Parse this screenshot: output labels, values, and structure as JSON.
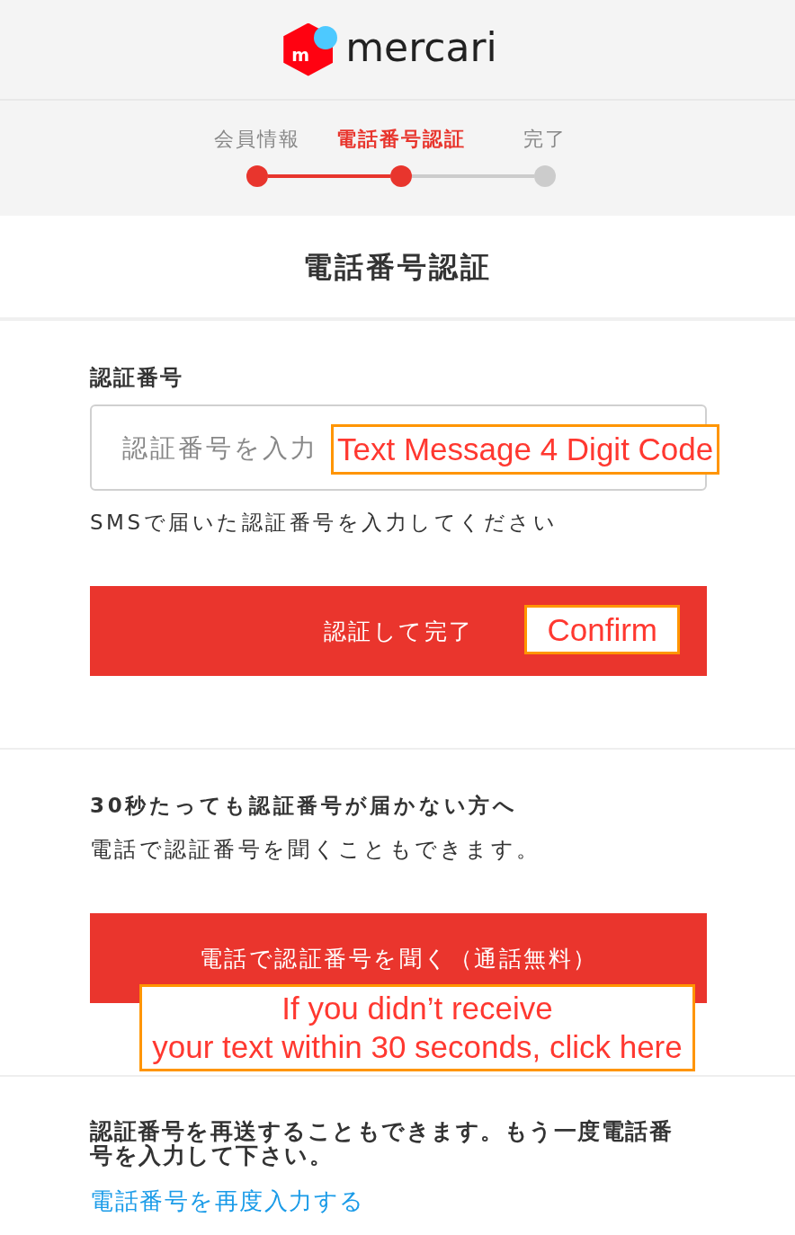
{
  "header": {
    "logo_mark": "m",
    "logo_text": "mercari"
  },
  "steps": [
    {
      "label": "会員情報",
      "selected": false,
      "reached": true
    },
    {
      "label": "電話番号認証",
      "selected": true,
      "reached": true
    },
    {
      "label": "完了",
      "selected": false,
      "reached": false
    }
  ],
  "page_title": "電話番号認証",
  "code_form": {
    "label": "認証番号",
    "input": {
      "placeholder": "認証番号を入力",
      "annotation": "Text Message 4 Digit Code"
    },
    "hint": "SMSで届いた認証番号を入力してください",
    "submit_button": {
      "label": "認証して完了",
      "annotation": "Confirm"
    }
  },
  "phone_call": {
    "heading": "30秒たっても認証番号が届かない方へ",
    "text": "電話で認証番号を聞くこともできます。",
    "button": {
      "label": "電話で認証番号を聞く（通話無料）",
      "annotation": "If you didn’t receive\nyour text within 30 seconds, click here"
    }
  },
  "resend": {
    "text": "認証番号を再送することもできます。もう一度電話番号を入力して下さい。",
    "link": "電話番号を再度入力する"
  }
}
